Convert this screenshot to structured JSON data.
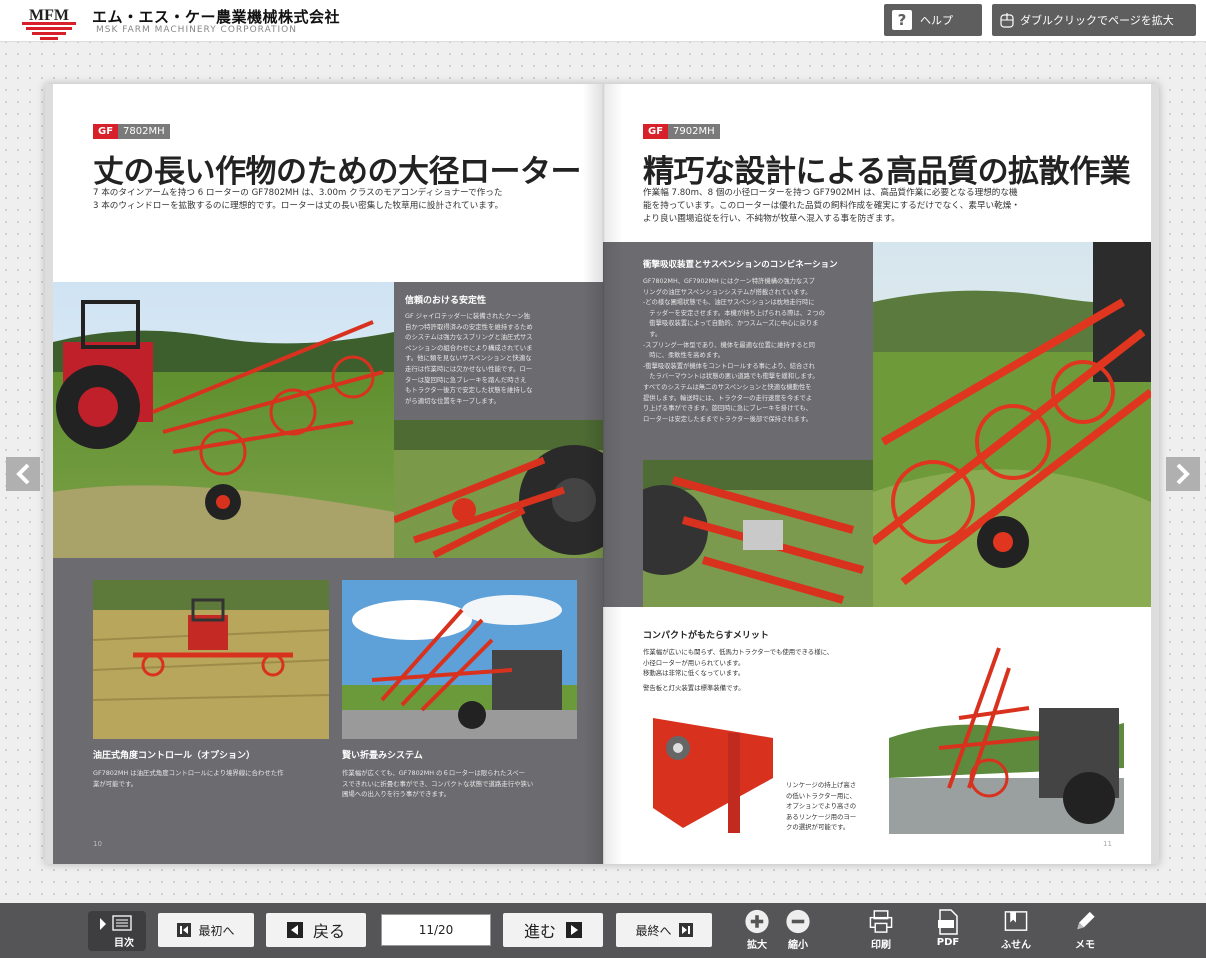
{
  "header": {
    "logo_text": "MFM",
    "company_name": "エム・エス・ケー農業機械株式会社",
    "company_sub": "MSK FARM MACHINERY CORPORATION",
    "help_label": "ヘルプ",
    "zoom_hint_label": "ダブルクリックでページを拡大"
  },
  "left_page": {
    "tag_gf": "GF",
    "tag_model": "7802MH",
    "title": "丈の長い作物のための大径ローター",
    "lead_1": "7 本のタインアームを持つ 6 ローターの GF7802MH は、3.00m クラスのモアコンディショナーで作った",
    "lead_2": "3 本のウィンドローを拡散するのに理想的です。ローターは丈の長い密集した牧草用に設計されています。",
    "stability_head": "信頼のおける安定性",
    "stability_body": [
      "GF ジャイロテッダーに装備されたクーン独",
      "自かつ特許取得済みの安定性を維持するため",
      "のシステムは強力なスプリングと油圧式サス",
      "ペンションの組合わせにより構成されていま",
      "す。他に類を見ないサスペンションと快適な",
      "走行は作業時には欠かせない性能です。ロー",
      "ターは旋回時に急ブレーキを踏んだ時さえ",
      "もトラクター後方で安定した状態を維持しな",
      "がら適切な位置をキープします。"
    ],
    "angle_head": "油圧式角度コントロール（オプション）",
    "angle_body": [
      "GF7802MH は油圧式角度コントロールにより境界線に合わせた作",
      "業が可能です。"
    ],
    "fold_head": "賢い折畳みシステム",
    "fold_body": [
      "作業幅が広くても、GF7802MH の６ローターは限られたスペー",
      "スできれいに折畳む事ができ、コンパクトな状態で道路走行や狭い",
      "圃場への出入りを行う事ができます。"
    ],
    "page_number": "10"
  },
  "right_page": {
    "tag_gf": "GF",
    "tag_model": "7902MH",
    "title": "精巧な設計による高品質の拡散作業",
    "lead_1": "作業幅 7.80m、8 個の小径ローターを持つ GF7902MH は、高品質作業に必要となる理想的な機",
    "lead_2": "能を持っています。このローターは優れた品質の飼料作成を確実にするだけでなく、素早い乾燥・",
    "lead_3": "より良い圃場追従を行い、不純物が牧草へ混入する事を防ぎます。",
    "suspension_head": "衝撃吸収装置とサスペンションのコンビネーション",
    "suspension_body": [
      "GF7802MH、GF7902MH にはクーン特許機構の強力なスプ",
      "リングの油圧サスペンションシステムが搭載されています。",
      "-どの様な圃場状態でも、油圧サスペンションは枕地走行時に",
      "　テッダーを安定させます。本機が持ち上げられる際は、２つの",
      "　衝撃吸収装置によって自動的、かつスムーズに中心に戻りま",
      "　す。",
      "-スプリング一体型であり、機体を最適な位置に維持すると同",
      "　時に、柔軟性を高めます。",
      "-衝撃吸収装置が機体をコントロールする事により、結合され",
      "　たラバーマウントは状態の悪い道路でも衝撃を緩和します。",
      "すべてのシステムは無二のサスペンションと快適な機動性を",
      "提供します。輸送時には、トラクターの走行速度を今までよ",
      "り上げる事ができます。旋回時に急にブレーキを掛けても、",
      "ローターは安定したままでトラクター後部で保持されます。"
    ],
    "compact_head": "コンパクトがもたらすメリット",
    "compact_body": [
      "作業幅が広いにも関らず、低馬力トラクターでも使用できる様に、",
      "小径ローターが用いられています。",
      "移動高は非常に低くなっています。",
      "警告板と灯火装置は標準装備です。"
    ],
    "linkage_body": [
      "リンケージの持上げ高さ",
      "の低いトラクター用に、",
      "オプションでより高さの",
      "あるリンケージ用のヨー",
      "クの選択が可能です。"
    ],
    "page_number": "11"
  },
  "toolbar": {
    "toc_label": "目次",
    "first_label": "最初へ",
    "back_label": "戻る",
    "page_value": "11/20",
    "next_label": "進む",
    "last_label": "最終へ",
    "zoom_in_label": "拡大",
    "zoom_out_label": "縮小",
    "print_label": "印刷",
    "pdf_label": "PDF",
    "sticky_label": "ふせん",
    "memo_label": "メモ"
  },
  "colors": {
    "brand_red": "#d7202a",
    "gray_panel": "#6c6c70",
    "toolbar_bg": "#555558"
  }
}
